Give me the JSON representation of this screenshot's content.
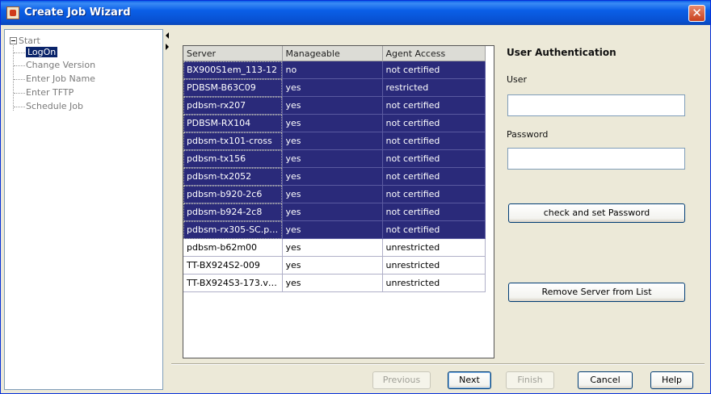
{
  "window": {
    "title": "Create Job Wizard"
  },
  "tree": {
    "root": "Start",
    "items": [
      {
        "label": "LogOn",
        "selected": true
      },
      {
        "label": "Change Version"
      },
      {
        "label": "Enter Job Name"
      },
      {
        "label": "Enter TFTP"
      },
      {
        "label": "Schedule Job"
      }
    ]
  },
  "table": {
    "headers": [
      "Server",
      "Manageable",
      "Agent Access"
    ],
    "rows": [
      {
        "server": "BX900S1em_113-12",
        "manageable": "no",
        "access": "not certified",
        "selected": true
      },
      {
        "server": "PDBSM-B63C09",
        "manageable": "yes",
        "access": "restricted",
        "selected": true
      },
      {
        "server": "pdbsm-rx207",
        "manageable": "yes",
        "access": "not certified",
        "selected": true
      },
      {
        "server": "PDBSM-RX104",
        "manageable": "yes",
        "access": "not certified",
        "selected": true
      },
      {
        "server": "pdbsm-tx101-cross",
        "manageable": "yes",
        "access": "not certified",
        "selected": true
      },
      {
        "server": "pdbsm-tx156",
        "manageable": "yes",
        "access": "not certified",
        "selected": true
      },
      {
        "server": "pdbsm-tx2052",
        "manageable": "yes",
        "access": "not certified",
        "selected": true
      },
      {
        "server": "pdbsm-b920-2c6",
        "manageable": "yes",
        "access": "not certified",
        "selected": true
      },
      {
        "server": "pdbsm-b924-2c8",
        "manageable": "yes",
        "access": "not certified",
        "selected": true
      },
      {
        "server": "pdbsm-rx305-SC.pll...",
        "manageable": "yes",
        "access": "not certified",
        "selected": true
      },
      {
        "server": "pdbsm-b62m00",
        "manageable": "yes",
        "access": "unrestricted",
        "selected": false
      },
      {
        "server": "TT-BX924S2-009",
        "manageable": "yes",
        "access": "unrestricted",
        "selected": false
      },
      {
        "server": "TT-BX924S3-173.vl...",
        "manageable": "yes",
        "access": "unrestricted",
        "selected": false
      }
    ]
  },
  "auth": {
    "heading": "User Authentication",
    "user_label": "User",
    "user_value": "",
    "password_label": "Password",
    "password_value": "",
    "check_button": "check and set Password",
    "remove_button": "Remove Server from List"
  },
  "footer": {
    "previous": "Previous",
    "next": "Next",
    "finish": "Finish",
    "cancel": "Cancel",
    "help": "Help"
  },
  "colors": {
    "selection": "#2a2a7a",
    "titlebar": "#0a5fe7"
  }
}
